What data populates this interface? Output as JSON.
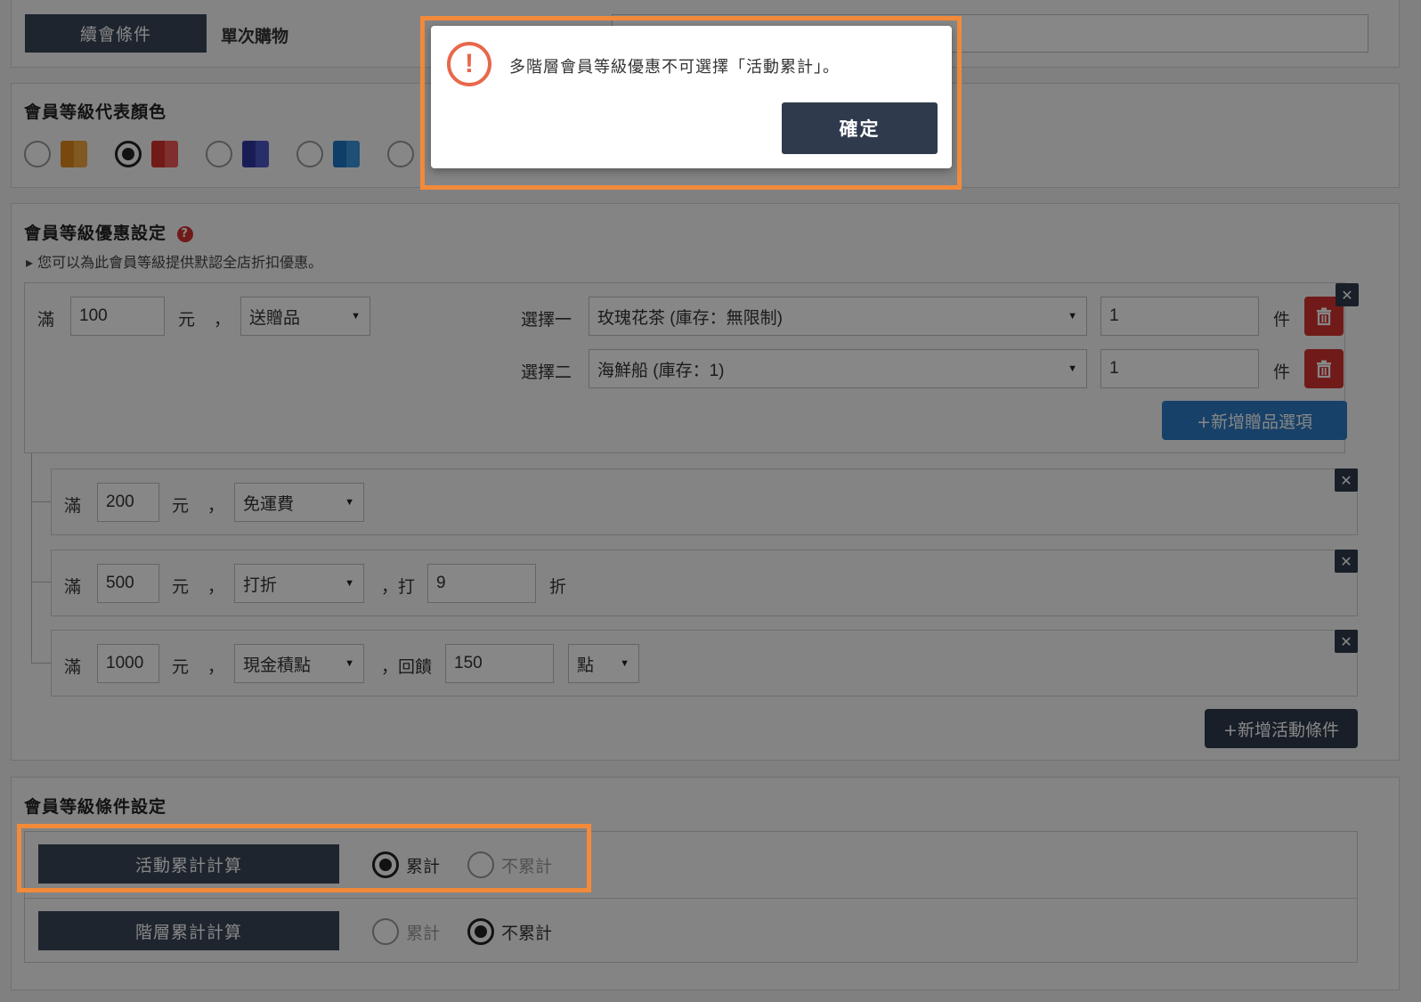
{
  "top_row": {
    "tab_active": "續會條件",
    "tab_other": "單次購物"
  },
  "color_section": {
    "title": "會員等級代表顏色",
    "swatches": [
      {
        "name": "orange",
        "c1": "#e08a1e",
        "c2": "#f0a640",
        "selected": false
      },
      {
        "name": "red",
        "c1": "#d8322f",
        "c2": "#ee5a57",
        "selected": true
      },
      {
        "name": "navy",
        "c1": "#2e3aa0",
        "c2": "#4a57c8",
        "selected": false
      },
      {
        "name": "blue",
        "c1": "#1d78c6",
        "c2": "#3b95dd",
        "selected": false
      }
    ]
  },
  "discount_section": {
    "title": "會員等級優惠設定",
    "hint": "▸ 您可以為此會員等級提供默認全店折扣優惠。",
    "tier1": {
      "prefix": "滿",
      "amount": "100",
      "unit": "元",
      "comma": "，",
      "type": "送贈品",
      "gift1_label": "選擇一",
      "gift1_value": "玫瑰花茶 (庫存：無限制)",
      "gift1_qty": "1",
      "gift2_label": "選擇二",
      "gift2_value": "海鮮船 (庫存：1)",
      "gift2_qty": "1",
      "qty_unit": "件",
      "add_gift": "+新增贈品選項"
    },
    "tier2": {
      "prefix": "滿",
      "amount": "200",
      "unit": "元",
      "comma": "，",
      "type": "免運費"
    },
    "tier3": {
      "prefix": "滿",
      "amount": "500",
      "unit": "元",
      "comma": "，",
      "type": "打折",
      "extra_label": "，打",
      "extra_value": "9",
      "extra_unit": "折"
    },
    "tier4": {
      "prefix": "滿",
      "amount": "1000",
      "unit": "元",
      "comma": "，",
      "type": "現金積點",
      "extra_label": "，回饋",
      "extra_value": "150",
      "extra_unit": "點"
    },
    "add_condition": "+新增活動條件"
  },
  "condition_section": {
    "title": "會員等級條件設定",
    "row1": {
      "label": "活動累計計算",
      "opt1": "累計",
      "opt2": "不累計",
      "selected": "opt1"
    },
    "row2": {
      "label": "階層累計計算",
      "opt1": "累計",
      "opt2": "不累計",
      "selected": "opt2"
    }
  },
  "modal": {
    "message": "多階層會員等級優惠不可選擇「活動累計」。",
    "confirm": "確定",
    "accent_color": "#f28a3a"
  }
}
